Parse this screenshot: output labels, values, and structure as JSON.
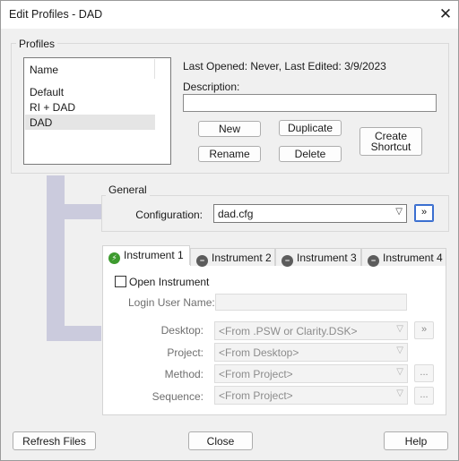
{
  "window": {
    "title": "Edit Profiles - DAD"
  },
  "icons": {
    "close": "close-icon",
    "dropdown": "chevron-down-icon",
    "instrument_active": "lightning-icon",
    "instrument_inactive": "minus-circle-icon"
  },
  "colors": {
    "accent": "#3b6fd0",
    "active_instrument": "#3d9a2e",
    "inactive_instrument": "#5c5c5c",
    "connector": "#cbcbdd"
  },
  "profiles": {
    "group_label": "Profiles",
    "list_header": "Name",
    "items": [
      "Default",
      "RI + DAD",
      "DAD"
    ],
    "selected": "DAD",
    "info": "Last Opened: Never, Last Edited: 3/9/2023",
    "description_label": "Description:",
    "description_value": "",
    "buttons": {
      "new": "New",
      "duplicate": "Duplicate",
      "rename": "Rename",
      "delete": "Delete",
      "create_shortcut_line1": "Create",
      "create_shortcut_line2": "Shortcut"
    }
  },
  "general": {
    "group_label": "General",
    "configuration_label": "Configuration:",
    "configuration_value": "dad.cfg",
    "expand_button": "»"
  },
  "instruments": {
    "tabs": [
      "Instrument 1",
      "Instrument 2",
      "Instrument 3",
      "Instrument 4"
    ],
    "active_tab": "Instrument 1",
    "open_instrument_label": "Open Instrument",
    "open_instrument_checked": false,
    "login_label": "Login User Name:",
    "login_value": "",
    "desktop_label": "Desktop:",
    "desktop_value": "<From .PSW or Clarity.DSK>",
    "desktop_button": "»",
    "project_label": "Project:",
    "project_value": "<From Desktop>",
    "method_label": "Method:",
    "method_value": "<From Project>",
    "method_button": "...",
    "sequence_label": "Sequence:",
    "sequence_value": "<From Project>",
    "sequence_button": "..."
  },
  "footer": {
    "refresh": "Refresh Files",
    "close": "Close",
    "help": "Help"
  }
}
